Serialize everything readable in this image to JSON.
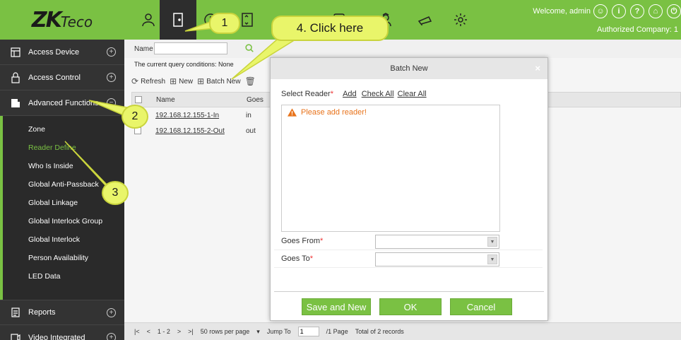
{
  "header": {
    "logo_main": "ZK",
    "logo_sub": "Teco",
    "welcome": "Welcome, admin",
    "company": "Authorized Company: 1",
    "nav_icons": [
      "person-icon",
      "door-icon",
      "attendance-icon",
      "elevator-icon",
      "parking-icon",
      "visitor-icon",
      "guard-icon",
      "patrol-icon",
      "settings-icon"
    ],
    "right_icons": [
      "user-circle-icon",
      "info-circle-icon",
      "help-circle-icon",
      "lock-circle-icon",
      "power-icon"
    ]
  },
  "sidebar": {
    "access_device": "Access Device",
    "access_control": "Access Control",
    "advanced_functions": "Advanced Functions",
    "sub_items": [
      {
        "label": "Zone"
      },
      {
        "label": "Reader Define"
      },
      {
        "label": "Who Is Inside"
      },
      {
        "label": "Global Anti-Passback"
      },
      {
        "label": "Global Linkage"
      },
      {
        "label": "Global Interlock Group"
      },
      {
        "label": "Global Interlock"
      },
      {
        "label": "Person Availability"
      },
      {
        "label": "LED Data"
      }
    ],
    "reports": "Reports",
    "video_integrated": "Video Integrated",
    "plus_sign": "⊕",
    "minus_sign": "⊖"
  },
  "filter": {
    "name_label": "Name",
    "conditions": "The current query conditions: None"
  },
  "toolbar": {
    "refresh": "Refresh",
    "new": "New",
    "batch_new": "Batch New"
  },
  "grid": {
    "col_name": "Name",
    "col_goes": "Goes",
    "rows": [
      {
        "name": "192.168.12.155-1-In",
        "goes": "in"
      },
      {
        "name": "192.168.12.155-2-Out",
        "goes": "out"
      }
    ]
  },
  "footer": {
    "pages": "1 - 2",
    "rows_per_page": "50 rows per page",
    "jump_to": "Jump To",
    "jump_value": "1",
    "page_info": "/1 Page",
    "total": "Total of 2 records"
  },
  "modal": {
    "title": "Batch New",
    "close": "×",
    "select_reader": "Select Reader",
    "required_mark": "*",
    "add": "Add",
    "check_all": "Check All",
    "clear_all": "Clear All",
    "warning": "Please add reader!",
    "goes_from": "Goes From",
    "goes_to": "Goes To",
    "save_and_new": "Save and New",
    "ok": "OK",
    "cancel": "Cancel"
  },
  "callouts": {
    "c1": "1",
    "c2": "2",
    "c3": "3",
    "c4": "4. Click here"
  },
  "colors": {
    "brand_green": "#7ac143",
    "sidebar_dark": "#333333",
    "callout_yellow": "#e9f56a",
    "warning_orange": "#e8731b"
  }
}
